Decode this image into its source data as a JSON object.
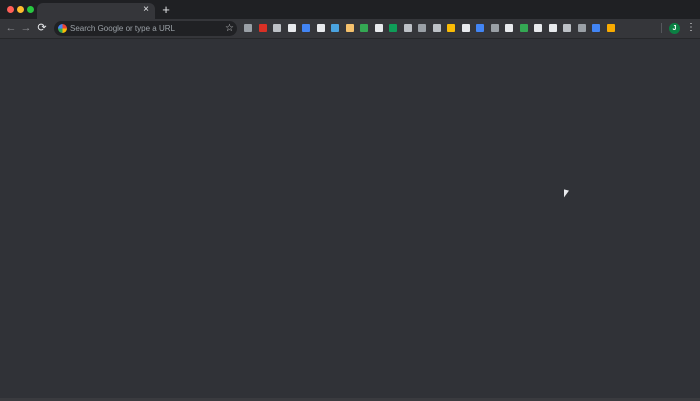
{
  "browser": {
    "tab": {
      "title": "",
      "close_label": "×"
    },
    "new_tab_label": "+",
    "nav": {
      "back_label": "←",
      "forward_label": "→",
      "reload_label": "⟳"
    },
    "omnibox": {
      "placeholder": "Search Google or type a URL",
      "bookmark_star": "☆"
    },
    "extensions": [
      {
        "name": "extension-1",
        "color": "#9aa0a6"
      },
      {
        "name": "extension-2",
        "color": "#d93025"
      },
      {
        "name": "extension-3",
        "color": "#bdc1c6"
      },
      {
        "name": "extension-4",
        "color": "#e8eaed"
      },
      {
        "name": "extension-5",
        "color": "#4285f4"
      },
      {
        "name": "extension-6",
        "color": "#e8eaed"
      },
      {
        "name": "extension-7",
        "color": "#4aa3df"
      },
      {
        "name": "extension-8",
        "color": "#f5c16c"
      },
      {
        "name": "extension-9",
        "color": "#34a853"
      },
      {
        "name": "extension-10",
        "color": "#e8eaed"
      },
      {
        "name": "extension-11",
        "color": "#0f9d58"
      },
      {
        "name": "extension-12",
        "color": "#bdc1c6"
      },
      {
        "name": "extension-13",
        "color": "#9aa0a6"
      },
      {
        "name": "extension-14",
        "color": "#bdc1c6"
      },
      {
        "name": "extension-15",
        "color": "#fbbc05"
      },
      {
        "name": "extension-16",
        "color": "#e8eaed"
      },
      {
        "name": "extension-17",
        "color": "#4285f4"
      },
      {
        "name": "extension-18",
        "color": "#9aa0a6"
      },
      {
        "name": "extension-19",
        "color": "#e8eaed"
      },
      {
        "name": "extension-20",
        "color": "#34a853"
      },
      {
        "name": "extension-21",
        "color": "#e8eaed"
      },
      {
        "name": "extension-22",
        "color": "#e8eaed"
      },
      {
        "name": "extension-23",
        "color": "#bdc1c6"
      },
      {
        "name": "extension-24",
        "color": "#9aa0a6"
      },
      {
        "name": "extension-25",
        "color": "#4285f4"
      },
      {
        "name": "extension-26",
        "color": "#f9ab00"
      }
    ],
    "profile_initial": "J",
    "menu_label": "⋮"
  },
  "colors": {
    "close": "#ff5f57",
    "minimize": "#febc2e",
    "maximize": "#28c840",
    "page_background": "#303237"
  }
}
